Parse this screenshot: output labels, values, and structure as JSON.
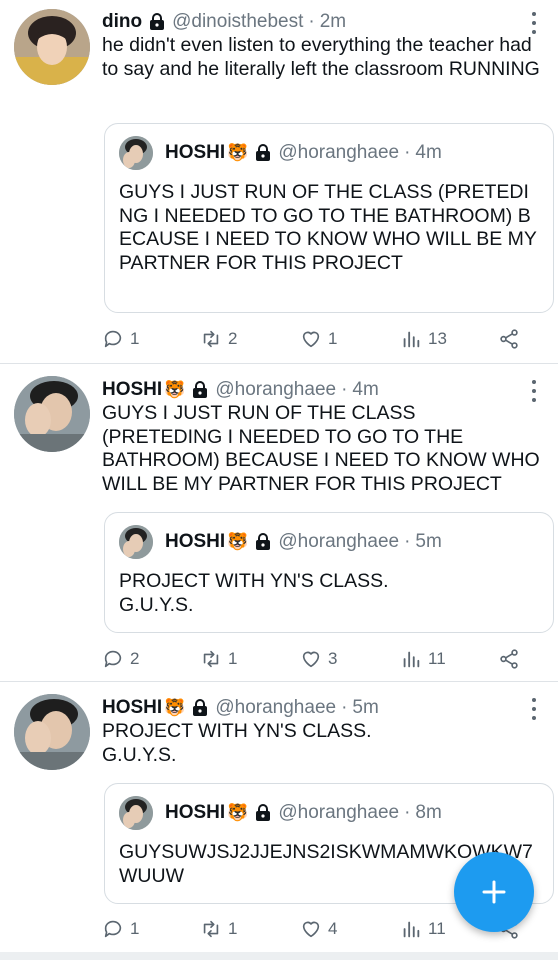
{
  "colors": {
    "accent": "#1d9bf0",
    "muted": "#6b7680",
    "border": "#d7dde2"
  },
  "tweets": [
    {
      "name": "dino",
      "emoji": "",
      "handle": "@dinoisthebest",
      "time": "2m",
      "separator": "·",
      "text": "he didn't even listen to everything the teacher had to say and he literally left the classroom RUNNING",
      "quote": {
        "name": "HOSHI",
        "emoji": "🐯",
        "handle": "@horanghaee",
        "time": "4m",
        "separator": "·",
        "text": "GUYS I JUST RUN OF THE CLASS (PRETEDING I NEEDED TO GO TO THE BATHROOM) BECAUSE I NEED TO KNOW WHO WILL BE MY PARTNER FOR THIS PROJECT"
      },
      "stats": {
        "replies": "1",
        "retweets": "2",
        "likes": "1",
        "views": "13"
      }
    },
    {
      "name": "HOSHI",
      "emoji": "🐯",
      "handle": "@horanghaee",
      "time": "4m",
      "separator": "·",
      "text": "GUYS I JUST RUN OF THE CLASS (PRETEDING I NEEDED TO GO TO THE BATHROOM) BECAUSE I NEED TO KNOW WHO WILL BE MY PARTNER FOR THIS PROJECT",
      "quote": {
        "name": "HOSHI",
        "emoji": "🐯",
        "handle": "@horanghaee",
        "time": "5m",
        "separator": "·",
        "text": "PROJECT WITH YN'S CLASS.\nG.U.Y.S."
      },
      "stats": {
        "replies": "2",
        "retweets": "1",
        "likes": "3",
        "views": "11"
      }
    },
    {
      "name": "HOSHI",
      "emoji": "🐯",
      "handle": "@horanghaee",
      "time": "5m",
      "separator": "·",
      "text": "PROJECT WITH YN'S CLASS.\nG.U.Y.S.",
      "quote": {
        "name": "HOSHI",
        "emoji": "🐯",
        "handle": "@horanghaee",
        "time": "8m",
        "separator": "·",
        "text": "GUYSUWJSJ2JJEJNS2ISKWMAMWKOWKW7WUUW"
      },
      "stats": {
        "replies": "1",
        "retweets": "1",
        "likes": "4",
        "views": "11"
      }
    }
  ],
  "icons": {
    "lock": "lock-icon",
    "more": "more-vertical-icon",
    "reply": "reply-icon",
    "retweet": "retweet-icon",
    "like": "heart-icon",
    "views": "views-icon",
    "share": "share-icon",
    "compose": "plus-icon"
  }
}
